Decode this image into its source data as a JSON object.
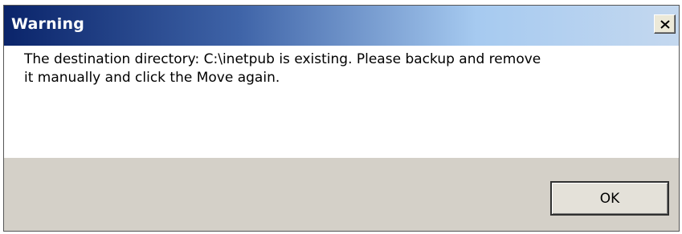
{
  "dialog": {
    "title": "Warning",
    "close_icon": "close-icon",
    "message_line1": "The destination directory: C:\\inetpub is existing. Please backup and remove",
    "message_line2": "it manually and click the Move again.",
    "ok_label": "OK"
  },
  "colors": {
    "title_bar_start": "#0a246a",
    "title_bar_end": "#c4d8ef",
    "button_area": "#d4d0c8",
    "content_background": "#ffffff"
  }
}
